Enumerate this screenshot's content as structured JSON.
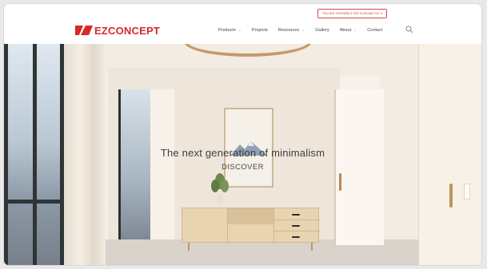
{
  "header": {
    "region_notice": "You are currently in EZ Concept AU",
    "logo_text": "EZCONCEPT",
    "brand_color": "#d8282c",
    "nav": [
      {
        "label": "Products",
        "has_dropdown": true
      },
      {
        "label": "Projects",
        "has_dropdown": false
      },
      {
        "label": "Resources",
        "has_dropdown": true
      },
      {
        "label": "Gallery",
        "has_dropdown": false
      },
      {
        "label": "About",
        "has_dropdown": true
      },
      {
        "label": "Contact",
        "has_dropdown": false
      }
    ],
    "search_icon": "search-icon"
  },
  "hero": {
    "title": "The next generation of minimalism",
    "cta": "DISCOVER"
  }
}
